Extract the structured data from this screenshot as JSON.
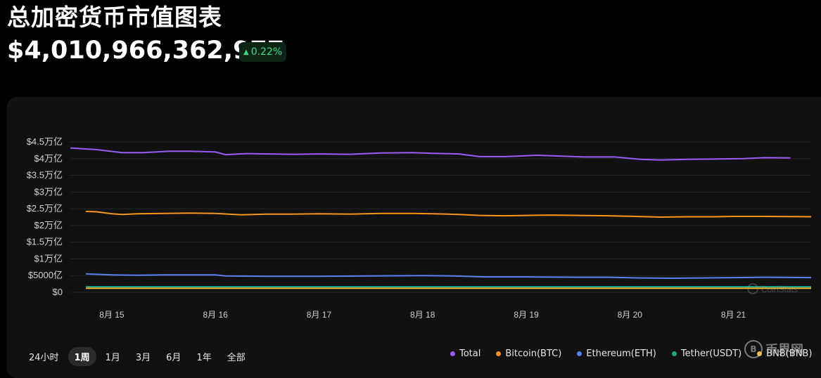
{
  "header": {
    "title": "总加密货币市值图表",
    "market_cap": "$4,010,966,362,977",
    "change": "0.22%",
    "change_color": "#3ddc84"
  },
  "range_selector": {
    "options": [
      "24小时",
      "1周",
      "1月",
      "3月",
      "6月",
      "1年",
      "全部"
    ],
    "active": "1周"
  },
  "watermark": {
    "text": "币界网",
    "chart_watermark": "CoinStats"
  },
  "chart_data": {
    "type": "line",
    "title": "",
    "xlabel": "",
    "ylabel": "",
    "ylim": [
      0,
      4.5
    ],
    "yticks": [
      0,
      0.5,
      1,
      1.5,
      2,
      2.5,
      3,
      3.5,
      4,
      4.5
    ],
    "ytick_labels": [
      "$0",
      "$5000亿",
      "$1万亿",
      "$1.5万亿",
      "$2万亿",
      "$2.5万亿",
      "$3万亿",
      "$3.5万亿",
      "$4万亿",
      "$4.5万亿"
    ],
    "xlim": [
      14.6,
      21.75
    ],
    "xticks": [
      15,
      16,
      17,
      18,
      19,
      20,
      21
    ],
    "xtick_labels": [
      "8月 15",
      "8月 16",
      "8月 17",
      "8月 18",
      "8月 19",
      "8月 20",
      "8月 21"
    ],
    "grid": true,
    "legend_position": "bottom-right",
    "series": [
      {
        "name": "Total",
        "color": "#9b59f5",
        "x": [
          14.6,
          14.85,
          15.1,
          15.3,
          15.55,
          15.75,
          16.0,
          16.1,
          16.3,
          16.5,
          16.75,
          17.0,
          17.3,
          17.6,
          17.9,
          18.1,
          18.35,
          18.55,
          18.8,
          19.1,
          19.3,
          19.55,
          19.85,
          20.1,
          20.3,
          20.55,
          20.85,
          21.1,
          21.3,
          21.55
        ],
        "y": [
          4.32,
          4.27,
          4.18,
          4.18,
          4.22,
          4.22,
          4.2,
          4.12,
          4.15,
          4.14,
          4.13,
          4.14,
          4.13,
          4.17,
          4.18,
          4.16,
          4.14,
          4.06,
          4.06,
          4.1,
          4.08,
          4.05,
          4.05,
          3.98,
          3.96,
          3.98,
          3.99,
          4.0,
          4.03,
          4.02
        ]
      },
      {
        "name": "Bitcoin(BTC)",
        "color": "#f7931a",
        "x": [
          14.75,
          14.85,
          15.0,
          15.1,
          15.25,
          15.5,
          15.75,
          16.0,
          16.25,
          16.5,
          16.75,
          17.0,
          17.3,
          17.6,
          17.9,
          18.1,
          18.35,
          18.55,
          18.8,
          19.0,
          19.25,
          19.5,
          19.8,
          20.05,
          20.3,
          20.55,
          20.8,
          21.0,
          21.3,
          21.75
        ],
        "y": [
          2.42,
          2.41,
          2.35,
          2.33,
          2.35,
          2.36,
          2.37,
          2.36,
          2.32,
          2.34,
          2.34,
          2.35,
          2.34,
          2.36,
          2.36,
          2.35,
          2.33,
          2.3,
          2.29,
          2.3,
          2.31,
          2.3,
          2.29,
          2.27,
          2.25,
          2.26,
          2.26,
          2.27,
          2.27,
          2.26
        ]
      },
      {
        "name": "Ethereum(ETH)",
        "color": "#5b7ff2",
        "x": [
          14.75,
          15.0,
          15.25,
          15.5,
          15.75,
          16.0,
          16.1,
          16.5,
          17.0,
          17.5,
          18.0,
          18.3,
          18.6,
          19.0,
          19.5,
          19.8,
          20.1,
          20.4,
          20.7,
          21.0,
          21.3,
          21.75
        ],
        "y": [
          0.55,
          0.52,
          0.51,
          0.52,
          0.52,
          0.52,
          0.49,
          0.48,
          0.48,
          0.49,
          0.5,
          0.49,
          0.46,
          0.46,
          0.45,
          0.45,
          0.43,
          0.42,
          0.43,
          0.44,
          0.45,
          0.44
        ]
      },
      {
        "name": "Tether(USDT)",
        "color": "#1aa68f",
        "x": [
          14.75,
          15.5,
          16.5,
          17.5,
          18.5,
          19.5,
          20.5,
          21.75
        ],
        "y": [
          0.167,
          0.167,
          0.167,
          0.167,
          0.167,
          0.167,
          0.167,
          0.167
        ]
      },
      {
        "name": "BNB(BNB)",
        "color": "#f3ba2f",
        "x": [
          14.75,
          15.5,
          16.5,
          17.5,
          18.5,
          19.5,
          20.5,
          21.75
        ],
        "y": [
          0.12,
          0.12,
          0.12,
          0.12,
          0.12,
          0.12,
          0.12,
          0.12
        ]
      }
    ]
  }
}
